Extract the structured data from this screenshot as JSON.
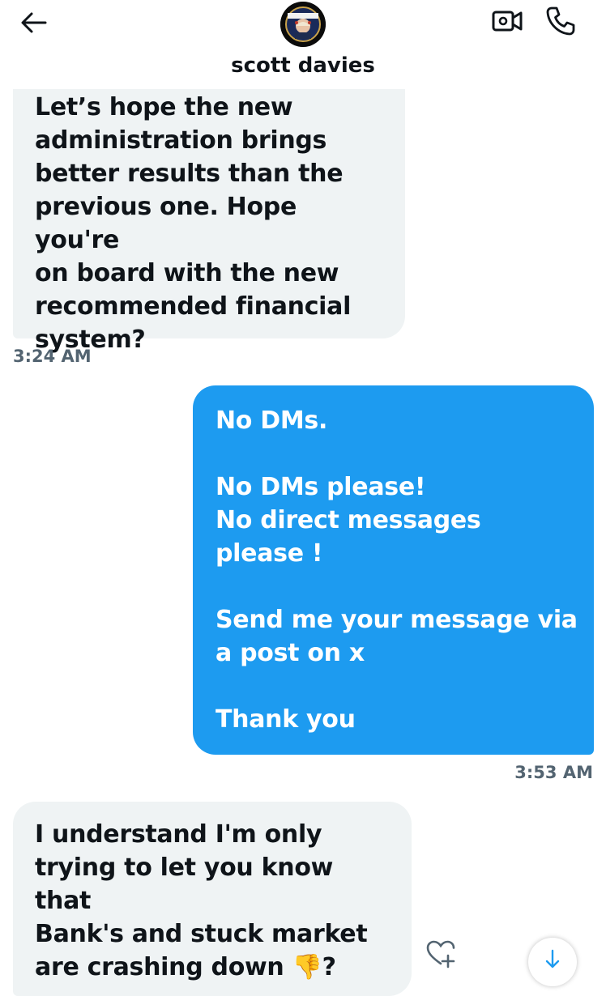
{
  "header": {
    "contact_name": "scott davies",
    "back_icon": "arrow-left-icon",
    "video_icon": "video-call-icon",
    "call_icon": "phone-icon"
  },
  "messages": [
    {
      "direction": "incoming",
      "text": "Let’s hope the new\nadministration brings\nbetter results than the\nprevious one. Hope you're\non board with the new\nrecommended financial\nsystem?",
      "time": "3:24 AM"
    },
    {
      "direction": "outgoing",
      "text": "No DMs.\n\nNo DMs please!\nNo direct messages\nplease !\n\nSend me your message via\na post on x\n\nThank you",
      "time": "3:53 AM"
    },
    {
      "direction": "incoming",
      "text": "I understand I'm only\ntrying to let you know that\nBank's and stuck market\nare crashing down 👎?"
    }
  ],
  "actions": {
    "react_icon": "heart-plus-icon",
    "scroll_icon": "arrow-down-icon"
  },
  "colors": {
    "outgoing_bubble": "#1d9bf0",
    "incoming_bubble": "#eff3f4",
    "timestamp": "#536471"
  }
}
